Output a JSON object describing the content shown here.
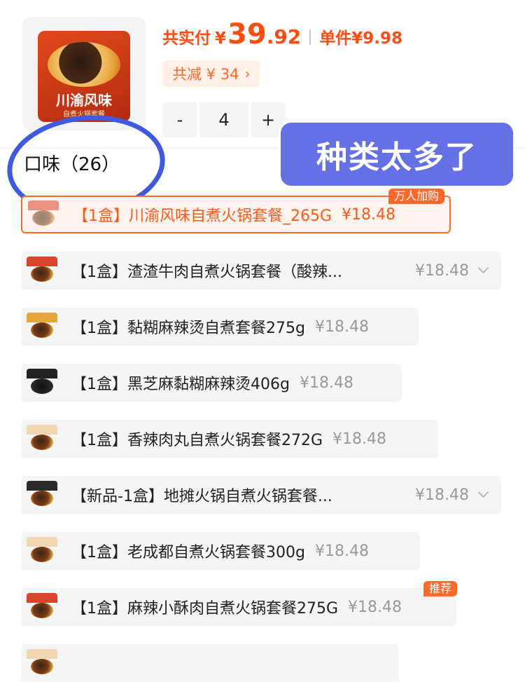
{
  "summary": {
    "total_label": "共实付",
    "currency": "¥",
    "total_int": "39",
    "total_dec": ".92",
    "unit_label": "单件¥9.98",
    "discount_label": "共减 ¥ 34",
    "discount_chevron": "›",
    "product_image_text": "川渝风味",
    "product_image_subtext": "自煮火锅套餐"
  },
  "stepper": {
    "minus": "-",
    "qty": "4",
    "plus": "+"
  },
  "section": {
    "title": "口味（26）",
    "view_mode": "大图"
  },
  "overlay_text": "种类太多了",
  "options": [
    {
      "name": "【1盒】川渝风味自煮火锅套餐_265G",
      "price": "¥18.48",
      "selected": true,
      "tag": "万人加购"
    },
    {
      "name": "【1盒】渣渣牛肉自煮火锅套餐（酸辣...",
      "price": "¥18.48",
      "expandable": true
    },
    {
      "name": "【1盒】黏糊麻辣烫自煮套餐275g",
      "price": "¥18.48"
    },
    {
      "name": "【1盒】黑芝麻黏糊麻辣烫406g",
      "price": "¥18.48"
    },
    {
      "name": "【1盒】香辣肉丸自煮火锅套餐272G",
      "price": "¥18.48"
    },
    {
      "name": "【新品-1盒】地摊火锅自煮火锅套餐...",
      "price": "¥18.48",
      "expandable": true
    },
    {
      "name": "【1盒】老成都自煮火锅套餐300g",
      "price": "¥18.48"
    },
    {
      "name": "【1盒】麻辣小酥肉自煮火锅套餐275G",
      "price": "¥18.48",
      "tag": "推荐"
    }
  ],
  "colors": {
    "accent": "#ff4d12",
    "annotation": "#3f5ae0",
    "overlay_bg": "#6470e4"
  }
}
